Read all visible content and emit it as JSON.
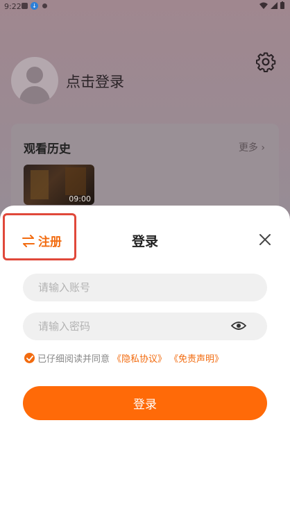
{
  "status_bar": {
    "time": "9:22"
  },
  "profile": {
    "login_prompt": "点击登录"
  },
  "history": {
    "title": "观看历史",
    "more": "更多 ›",
    "items": [
      {
        "duration": "09:00"
      }
    ]
  },
  "sheet": {
    "register_label": "注册",
    "title": "登录",
    "account_placeholder": "请输入账号",
    "password_placeholder": "请输入密码",
    "agreement_prefix": "已仔细阅读并同意",
    "privacy_link": "《隐私协议》",
    "disclaimer_link": "《免责声明》",
    "login_button": "登录"
  },
  "colors": {
    "accent": "#ff6a08",
    "highlight_border": "#e0483a"
  },
  "icons": [
    "gear-icon",
    "swap-icon",
    "close-icon",
    "eye-icon",
    "check-icon",
    "avatar-icon"
  ]
}
